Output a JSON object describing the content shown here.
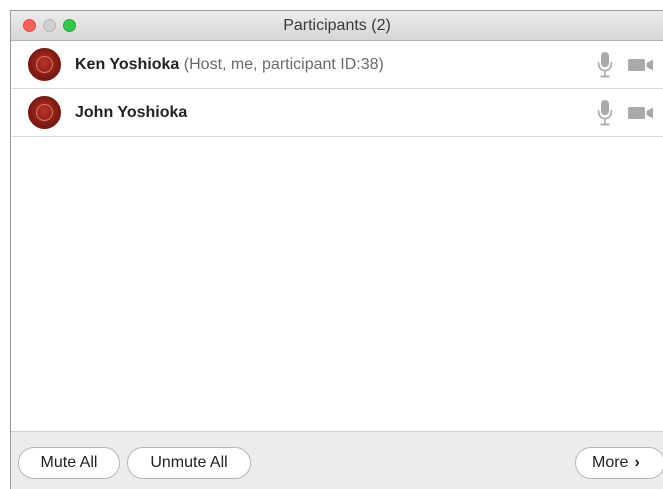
{
  "window": {
    "title": "Participants (2)"
  },
  "participants": [
    {
      "name": "Ken Yoshioka",
      "meta": "(Host, me, participant ID:38)",
      "mic_icon": "microphone-icon",
      "video_icon": "video-camera-icon"
    },
    {
      "name": "John Yoshioka",
      "meta": "",
      "mic_icon": "microphone-icon",
      "video_icon": "video-camera-icon"
    }
  ],
  "footer": {
    "mute_all_label": "Mute All",
    "unmute_all_label": "Unmute All",
    "more_label": "More",
    "more_icon": "chevron-right-icon"
  },
  "colors": {
    "close": "#fc605b",
    "minimize": "#d0d0d0",
    "maximize": "#34c84a",
    "avatar": "#8a1e16",
    "icon_gray": "#a9a9a9"
  }
}
